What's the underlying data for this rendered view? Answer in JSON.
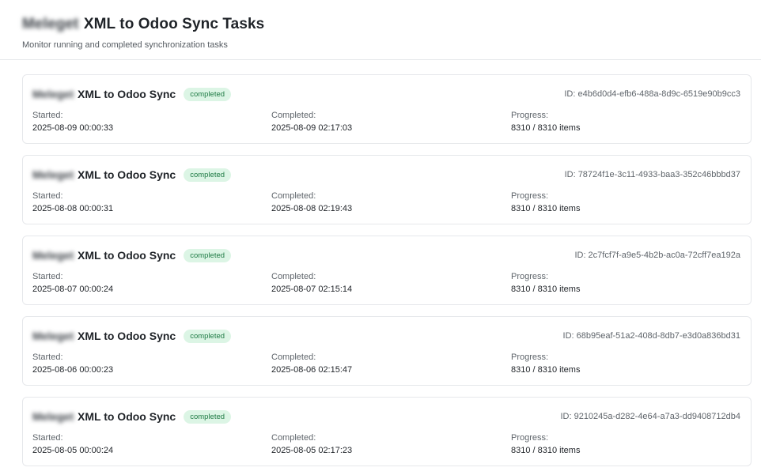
{
  "header": {
    "title_prefix": "Meleget",
    "title": "XML to Odoo Sync Tasks",
    "subtitle": "Monitor running and completed synchronization tasks"
  },
  "field_labels": {
    "started": "Started:",
    "completed": "Completed:",
    "progress": "Progress:"
  },
  "tasks": [
    {
      "name_prefix": "Meleget",
      "name": "XML to Odoo Sync",
      "status": "completed",
      "id": "ID: e4b6d0d4-efb6-488a-8d9c-6519e90b9cc3",
      "started": "2025-08-09 00:00:33",
      "completed": "2025-08-09 02:17:03",
      "progress": "8310 / 8310 items"
    },
    {
      "name_prefix": "Meleget",
      "name": "XML to Odoo Sync",
      "status": "completed",
      "id": "ID: 78724f1e-3c11-4933-baa3-352c46bbbd37",
      "started": "2025-08-08 00:00:31",
      "completed": "2025-08-08 02:19:43",
      "progress": "8310 / 8310 items"
    },
    {
      "name_prefix": "Meleget",
      "name": "XML to Odoo Sync",
      "status": "completed",
      "id": "ID: 2c7fcf7f-a9e5-4b2b-ac0a-72cff7ea192a",
      "started": "2025-08-07 00:00:24",
      "completed": "2025-08-07 02:15:14",
      "progress": "8310 / 8310 items"
    },
    {
      "name_prefix": "Meleget",
      "name": "XML to Odoo Sync",
      "status": "completed",
      "id": "ID: 68b95eaf-51a2-408d-8db7-e3d0a836bd31",
      "started": "2025-08-06 00:00:23",
      "completed": "2025-08-06 02:15:47",
      "progress": "8310 / 8310 items"
    },
    {
      "name_prefix": "Meleget",
      "name": "XML to Odoo Sync",
      "status": "completed",
      "id": "ID: 9210245a-d282-4e64-a7a3-dd9408712db4",
      "started": "2025-08-05 00:00:24",
      "completed": "2025-08-05 02:17:23",
      "progress": "8310 / 8310 items"
    }
  ]
}
